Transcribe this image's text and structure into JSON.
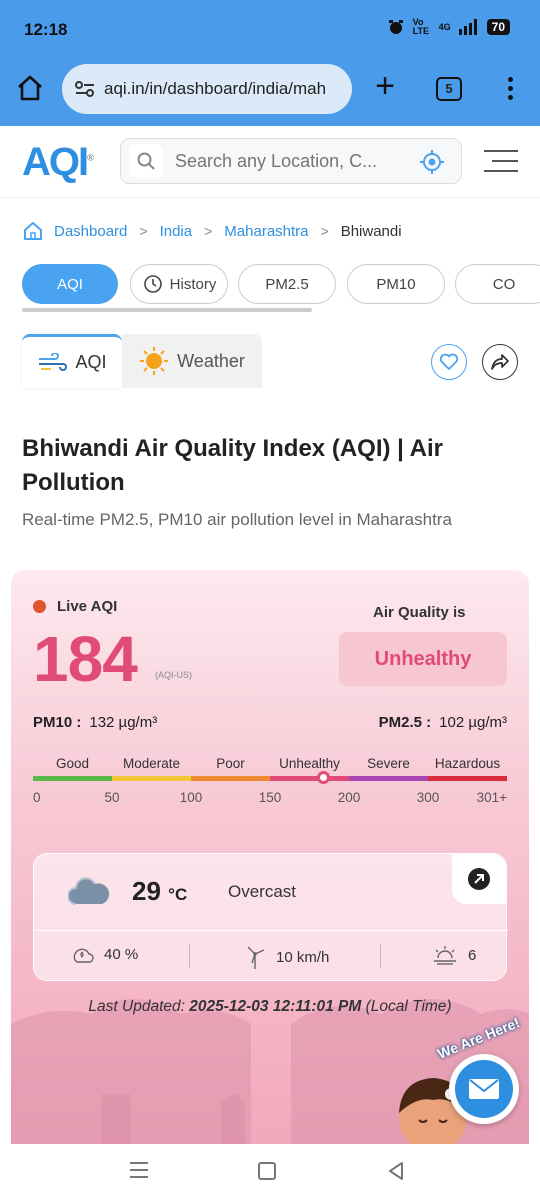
{
  "status_bar": {
    "time": "12:18",
    "network": "4G",
    "volte": "Vo LTE",
    "battery": "70"
  },
  "browser": {
    "url": "aqi.in/in/dashboard/india/mah",
    "tab_count": "5"
  },
  "site": {
    "logo": "AQI",
    "search_placeholder": "Search any Location, C..."
  },
  "breadcrumb": [
    "Dashboard",
    "India",
    "Maharashtra",
    "Bhiwandi"
  ],
  "pills": [
    {
      "label": "AQI"
    },
    {
      "label": "History"
    },
    {
      "label": "PM2.5"
    },
    {
      "label": "PM10"
    },
    {
      "label": "CO"
    }
  ],
  "tabs": {
    "aqi": "AQI",
    "weather": "Weather"
  },
  "page": {
    "title": "Bhiwandi Air Quality Index (AQI) | Air Pollution",
    "subtitle": "Real-time PM2.5, PM10 air pollution level in Maharashtra"
  },
  "aqi": {
    "live_label": "Live AQI",
    "value": "184",
    "unit": "(AQI-US)",
    "quality_label": "Air Quality is",
    "status": "Unhealthy",
    "pm10_label": "PM10 :",
    "pm10_value": "132 µg/m³",
    "pm25_label": "PM2.5 :",
    "pm25_value": "102 µg/m³",
    "scale": {
      "categories": [
        "Good",
        "Moderate",
        "Poor",
        "Unhealthy",
        "Severe",
        "Hazardous"
      ],
      "breakpoints": [
        "0",
        "50",
        "100",
        "150",
        "200",
        "300",
        "301+"
      ],
      "colors": [
        "#59b94a",
        "#f3c735",
        "#ef8a35",
        "#e04b77",
        "#a845b4",
        "#d82c3b"
      ],
      "marker_value": 184
    }
  },
  "weather": {
    "temp": "29",
    "temp_unit": "°C",
    "condition": "Overcast",
    "humidity": "40 %",
    "wind": "10 km/h",
    "uv": "6"
  },
  "last_updated": {
    "label": "Last Updated:",
    "datetime": "2025-12-03 12:11:01 PM",
    "suffix": "(Local Time)"
  },
  "chat": {
    "badge": "We Are Here!"
  }
}
